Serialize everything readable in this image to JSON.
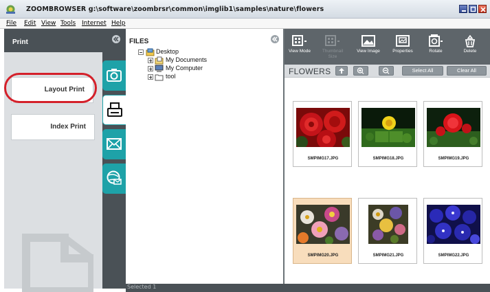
{
  "window": {
    "title": "ZOOMBROWSER g:\\software\\zoombrsr\\common\\imglib1\\samples\\nature\\flowers"
  },
  "menu": [
    "File",
    "Edit",
    "View",
    "Tools",
    "Internet",
    "Help"
  ],
  "print_panel": {
    "title": "Print",
    "options": [
      "Layout Print",
      "Index Print"
    ],
    "highlighted_option": "Layout Print",
    "side_tabs": [
      "camera-icon",
      "printer-icon",
      "email-icon",
      "web-icon"
    ],
    "active_tab": "printer-icon"
  },
  "files_panel": {
    "title": "FILES",
    "tree": [
      {
        "label": "Desktop",
        "toggle": "minus",
        "icon": "desktop-folder-icon"
      },
      {
        "label": "My Documents",
        "toggle": "plus",
        "icon": "documents-folder-icon"
      },
      {
        "label": "My Computer",
        "toggle": "plus",
        "icon": "computer-icon"
      },
      {
        "label": "tool",
        "toggle": "plus",
        "icon": "folder-icon"
      }
    ]
  },
  "toolbar": {
    "buttons": [
      {
        "label": "View Mode",
        "enabled": true,
        "icon": "view-mode-icon"
      },
      {
        "label": "Thumbnail Size",
        "enabled": false,
        "icon": "thumbnail-size-icon"
      },
      {
        "label": "View Image",
        "enabled": true,
        "icon": "view-image-icon"
      },
      {
        "label": "Properties",
        "enabled": true,
        "icon": "properties-icon"
      },
      {
        "label": "Rotate",
        "enabled": true,
        "icon": "rotate-icon"
      },
      {
        "label": "Delete",
        "enabled": true,
        "icon": "delete-icon"
      }
    ]
  },
  "folder_bar": {
    "name": "FLOWERS",
    "select_all": "Select All",
    "clear_all": "Clear All"
  },
  "thumbnails": [
    {
      "label": "SMPIMG17.JPG",
      "selected": false
    },
    {
      "label": "SMPIMG18.JPG",
      "selected": false
    },
    {
      "label": "SMPIMG19.JPG",
      "selected": false
    },
    {
      "label": "SMPIMG20.JPG",
      "selected": true
    },
    {
      "label": "SMPIMG21.JPG",
      "selected": false
    },
    {
      "label": "SMPIMG22.JPG",
      "selected": false
    }
  ],
  "status_bar": {
    "text": "Selected 1"
  },
  "colors": {
    "accent_teal": "#1ea2a8",
    "highlight_red": "#d4202a",
    "selected_thumb": "#f8ddbc",
    "dark_panel": "#4a5156"
  }
}
